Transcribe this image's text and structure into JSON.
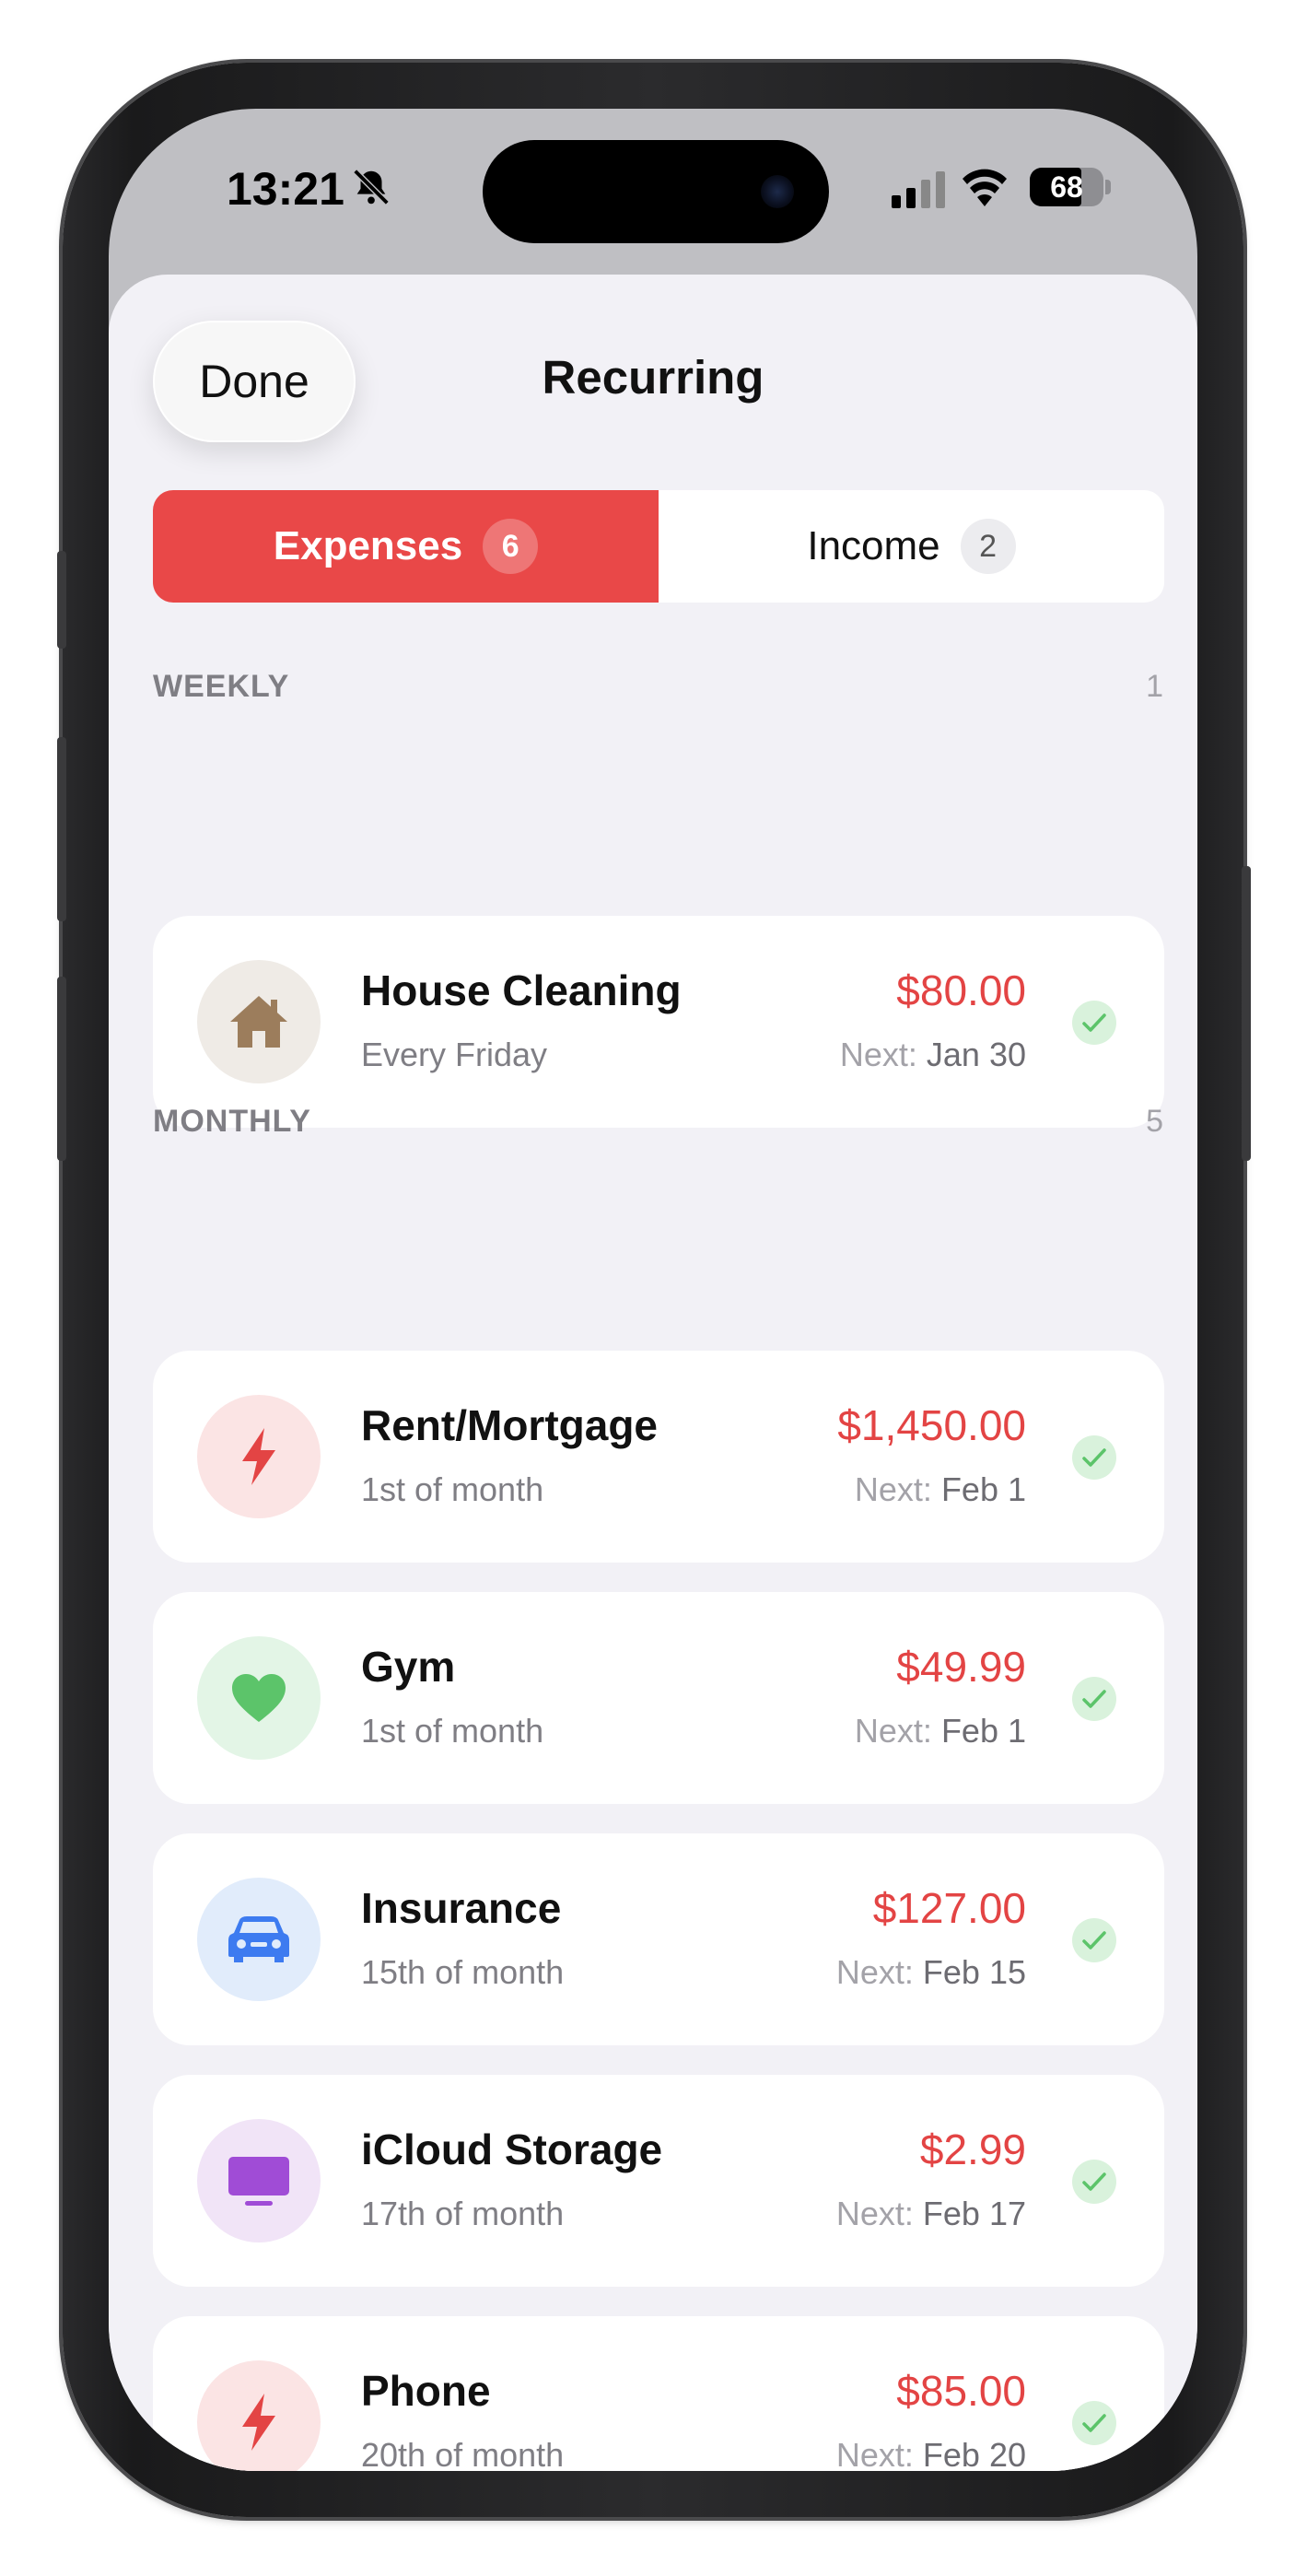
{
  "status_bar": {
    "time": "13:21",
    "battery": "68"
  },
  "header": {
    "done_label": "Done",
    "title": "Recurring"
  },
  "tabs": [
    {
      "label": "Expenses",
      "count": "6",
      "active": true
    },
    {
      "label": "Income",
      "count": "2",
      "active": false
    }
  ],
  "sections": [
    {
      "title": "WEEKLY",
      "count": "1",
      "items": [
        {
          "name": "House Cleaning",
          "schedule": "Every Friday",
          "amount": "$80.00",
          "next_label": "Next:",
          "next_date": "Jan 30",
          "icon": "house-icon",
          "icon_bg": "#efebe6",
          "icon_color": "#9c7d5c"
        }
      ]
    },
    {
      "title": "MONTHLY",
      "count": "5",
      "items": [
        {
          "name": "Rent/Mortgage",
          "schedule": "1st of month",
          "amount": "$1,450.00",
          "next_label": "Next:",
          "next_date": "Feb 1",
          "icon": "bolt-icon",
          "icon_bg": "#fbe4e4",
          "icon_color": "#e34444"
        },
        {
          "name": "Gym",
          "schedule": "1st of month",
          "amount": "$49.99",
          "next_label": "Next:",
          "next_date": "Feb 1",
          "icon": "heart-icon",
          "icon_bg": "#e3f5e6",
          "icon_color": "#5cc46a"
        },
        {
          "name": "Insurance",
          "schedule": "15th of month",
          "amount": "$127.00",
          "next_label": "Next:",
          "next_date": "Feb 15",
          "icon": "car-icon",
          "icon_bg": "#e1ecfb",
          "icon_color": "#3d7bf0"
        },
        {
          "name": "iCloud Storage",
          "schedule": "17th of month",
          "amount": "$2.99",
          "next_label": "Next:",
          "next_date": "Feb 17",
          "icon": "tv-icon",
          "icon_bg": "#f1e4f7",
          "icon_color": "#a04cd6"
        },
        {
          "name": "Phone",
          "schedule": "20th of month",
          "amount": "$85.00",
          "next_label": "Next:",
          "next_date": "Feb 20",
          "icon": "bolt-icon",
          "icon_bg": "#fbe4e4",
          "icon_color": "#e34444"
        }
      ]
    }
  ],
  "colors": {
    "accent": "#e94848",
    "amount": "#e34444",
    "check": "#5cc46a"
  }
}
